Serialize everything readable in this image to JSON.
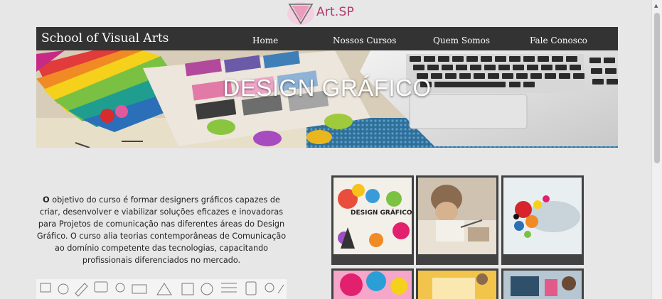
{
  "logo": {
    "text": "Art.SP"
  },
  "header": {
    "brand": "School of Visual Arts",
    "nav": [
      {
        "label": "Home"
      },
      {
        "label": "Nossos Cursos"
      },
      {
        "label": "Quem Somos"
      },
      {
        "label": "Fale Conosco"
      }
    ]
  },
  "hero": {
    "title": "DESIGN GRÁFICO"
  },
  "intro": {
    "lead": "O",
    "body": " objetivo do curso é formar designers gráficos capazes de criar, desenvolver e viabilizar soluções eficazes e inovadoras para Projetos de comunicação nas diferentes áreas do Design Gráfico. O curso alia teorias contemporâneas de Comunicação ao domínio competente das tecnologias, capacitando profissionais diferenciados no mercado."
  },
  "gallery": {
    "thumb_text": "DESIGN GRÁFICO"
  },
  "colors": {
    "background": "#e7e7e7",
    "navbar": "#333333",
    "logo": "#b2396d",
    "thumb_frame": "#424242"
  }
}
